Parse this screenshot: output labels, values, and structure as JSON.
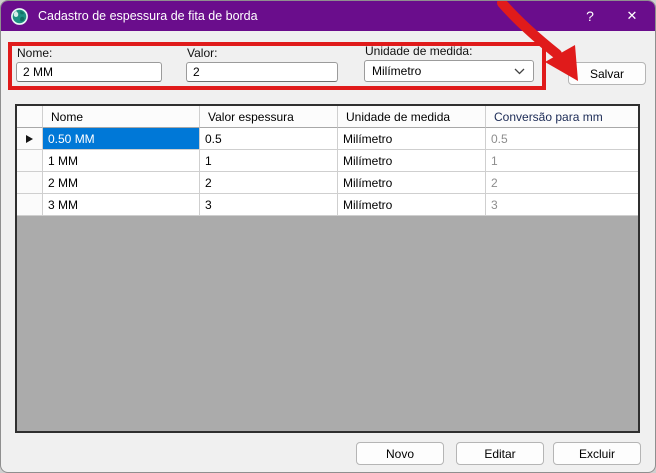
{
  "window": {
    "title": "Cadastro de espessura de fita de borda",
    "icon": "globe-icon",
    "help_glyph": "?",
    "close_glyph": "✕"
  },
  "form": {
    "name_label": "Nome:",
    "name_value": "2 MM",
    "value_label": "Valor:",
    "value_value": "2",
    "unit_label": "Unidade de medida:",
    "unit_value": "Milímetro",
    "save_label": "Salvar"
  },
  "grid": {
    "columns": [
      "Nome",
      "Valor espessura",
      "Unidade de medida",
      "Conversão para mm"
    ],
    "rows": [
      {
        "name": "0.50 MM",
        "value": "0.5",
        "unit": "Milímetro",
        "conversion": "0.5"
      },
      {
        "name": "1 MM",
        "value": "1",
        "unit": "Milímetro",
        "conversion": "1"
      },
      {
        "name": "2 MM",
        "value": "2",
        "unit": "Milímetro",
        "conversion": "2"
      },
      {
        "name": "3 MM",
        "value": "3",
        "unit": "Milímetro",
        "conversion": "3"
      }
    ],
    "selected_row_index": 0
  },
  "actions": {
    "new": "Novo",
    "edit": "Editar",
    "delete": "Excluir"
  },
  "colors": {
    "titlebar_purple": "#6A0D8C",
    "annotation_red": "#E01B1B",
    "selection_blue": "#0078D7",
    "grid_background_gray": "#ABABAB"
  }
}
